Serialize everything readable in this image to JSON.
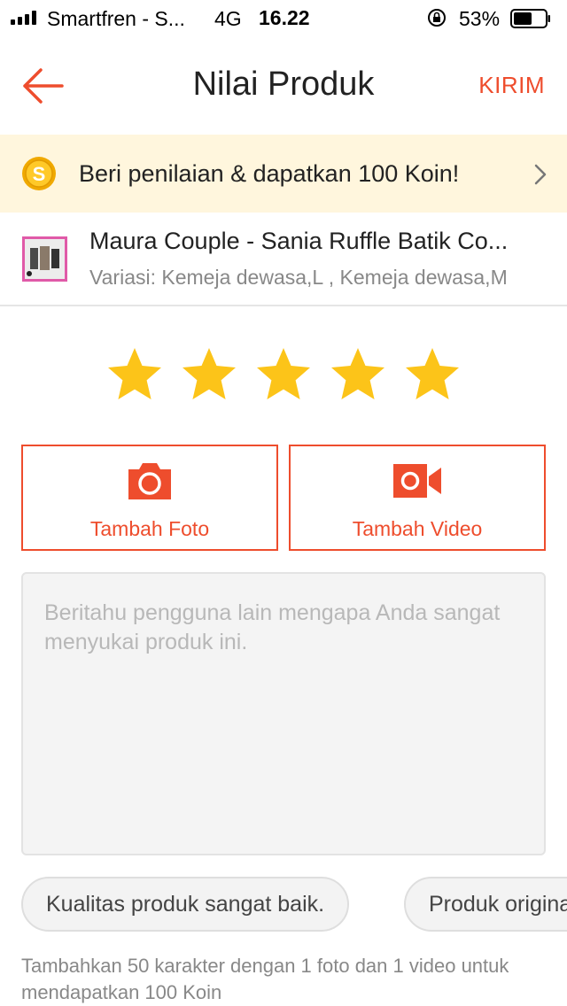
{
  "status_bar": {
    "carrier": "Smartfren - S...",
    "network": "4G",
    "time": "16.22",
    "battery_percent": "53%"
  },
  "header": {
    "title": "Nilai Produk",
    "send_label": "KIRIM"
  },
  "coin_banner": {
    "text": "Beri penilaian & dapatkan 100 Koin!"
  },
  "product": {
    "name": "Maura Couple - Sania Ruffle Batik Co...",
    "variation": "Variasi: Kemeja dewasa,L , Kemeja dewasa,M"
  },
  "rating": {
    "selected": 5,
    "max": 5
  },
  "media": {
    "photo_label": "Tambah Foto",
    "video_label": "Tambah Video"
  },
  "review": {
    "value": "",
    "placeholder": "Beritahu pengguna lain mengapa Anda sangat menyukai produk ini."
  },
  "quick_phrases": [
    "Kualitas produk sangat baik.",
    "Produk original."
  ],
  "hint": "Tambahkan 50 karakter dengan 1 foto dan 1 video untuk mendapatkan 100 Koin",
  "colors": {
    "accent": "#ee4d2d",
    "star": "#fcc419",
    "banner_bg": "#fff6dd"
  }
}
